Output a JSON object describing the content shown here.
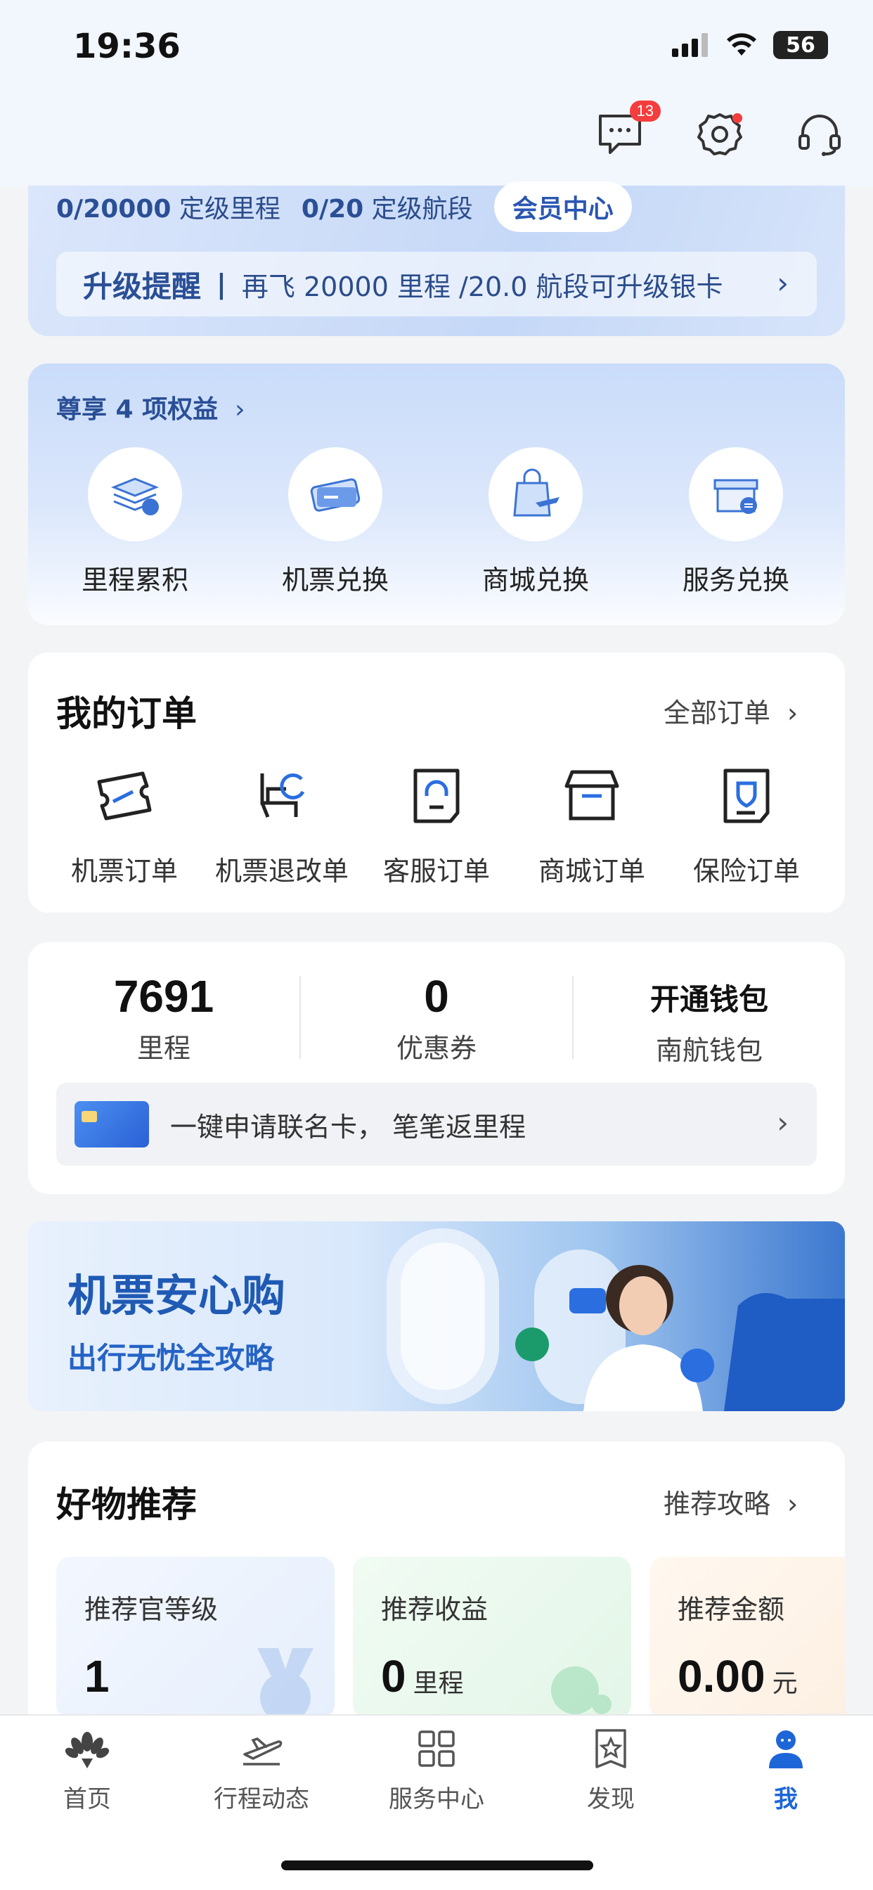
{
  "status_bar": {
    "time": "19:36",
    "battery": "56"
  },
  "header": {
    "message_badge": "13"
  },
  "member": {
    "qualifying_miles": "0/20000",
    "qualifying_miles_label": "定级里程",
    "qualifying_segments": "0/20",
    "qualifying_segments_label": "定级航段",
    "member_center_label": "会员中心",
    "upgrade_title": "升级提醒",
    "upgrade_text": "再飞 20000 里程 /20.0 航段可升级银卡"
  },
  "benefits": {
    "title": "尊享 4 项权益",
    "items": [
      {
        "label": "里程累积",
        "icon": "miles-stack-icon"
      },
      {
        "label": "机票兑换",
        "icon": "ticket-exchange-icon"
      },
      {
        "label": "商城兑换",
        "icon": "shopping-bag-icon"
      },
      {
        "label": "服务兑换",
        "icon": "service-store-icon"
      }
    ]
  },
  "orders": {
    "title": "我的订单",
    "all_orders": "全部订单",
    "items": [
      {
        "label": "机票订单",
        "icon": "ticket-icon"
      },
      {
        "label": "机票退改单",
        "icon": "seat-refresh-icon"
      },
      {
        "label": "客服订单",
        "icon": "headset-doc-icon"
      },
      {
        "label": "商城订单",
        "icon": "store-icon"
      },
      {
        "label": "保险订单",
        "icon": "shield-doc-icon"
      }
    ]
  },
  "wallet": {
    "miles_value": "7691",
    "miles_label": "里程",
    "coupons_value": "0",
    "coupons_label": "优惠券",
    "wallet_value": "开通钱包",
    "wallet_label": "南航钱包",
    "cobrand_text": "一键申请联名卡， 笔笔返里程"
  },
  "banner": {
    "title": "机票安心购",
    "subtitle": "出行无忧全攻略"
  },
  "recommend": {
    "title": "好物推荐",
    "link": "推荐攻略",
    "cards": [
      {
        "label": "推荐官等级",
        "value": "1",
        "unit": ""
      },
      {
        "label": "推荐收益",
        "value": "0",
        "unit": "里程"
      },
      {
        "label": "推荐金额",
        "value": "0.00",
        "unit": "元"
      }
    ]
  },
  "tabs": [
    {
      "label": "首页",
      "icon": "home-flower-icon"
    },
    {
      "label": "行程动态",
      "icon": "plane-icon"
    },
    {
      "label": "服务中心",
      "icon": "grid-icon"
    },
    {
      "label": "发现",
      "icon": "star-bookmark-icon"
    },
    {
      "label": "我",
      "icon": "person-icon"
    }
  ],
  "colors": {
    "accent": "#1d66d8",
    "badge": "#f43d3d"
  }
}
